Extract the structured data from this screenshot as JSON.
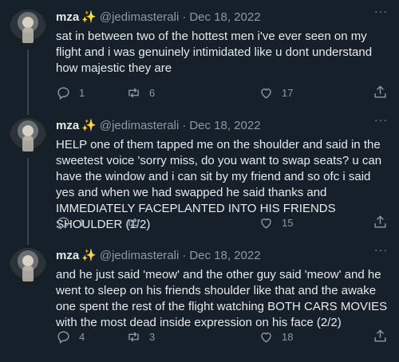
{
  "tweets": [
    {
      "name": "mza",
      "sparkle": "✨",
      "handle": "@jedimasterali",
      "sep": "·",
      "date": "Dec 18, 2022",
      "more": "···",
      "text": "sat in between two of the hottest men i've ever seen on my flight and i was genuinely intimidated like u dont understand how majestic they are",
      "replies": "1",
      "retweets": "6",
      "likes": "17"
    },
    {
      "name": "mza",
      "sparkle": "✨",
      "handle": "@jedimasterali",
      "sep": "·",
      "date": "Dec 18, 2022",
      "more": "···",
      "text": "HELP one of them tapped me on the shoulder and said in the sweetest voice 'sorry miss, do you want to swap seats? u can have the window and i can sit by my friend and so ofc i said yes and when we had swapped he said thanks and IMMEDIATELY FACEPLANTED INTO HIS FRIENDS SHOULDER (1/2)",
      "replies": "1",
      "retweets": "",
      "likes": "15"
    },
    {
      "name": "mza",
      "sparkle": "✨",
      "handle": "@jedimasterali",
      "sep": "·",
      "date": "Dec 18, 2022",
      "more": "···",
      "text": "and he just said 'meow' and the other guy said 'meow' and he went to sleep on his friends shoulder like that and the awake one spent the rest of the flight watching BOTH CARS MOVIES with the most dead inside expression on his face (2/2)",
      "replies": "4",
      "retweets": "3",
      "likes": "18"
    }
  ],
  "icons": {
    "reply": "reply-icon",
    "retweet": "retweet-icon",
    "like": "heart-icon",
    "share": "share-icon"
  },
  "colors": {
    "background": "#15202b",
    "text": "#e7e9ea",
    "secondary": "#8b98a5",
    "sparkle": "#f5c518",
    "divider": "#38444d"
  }
}
